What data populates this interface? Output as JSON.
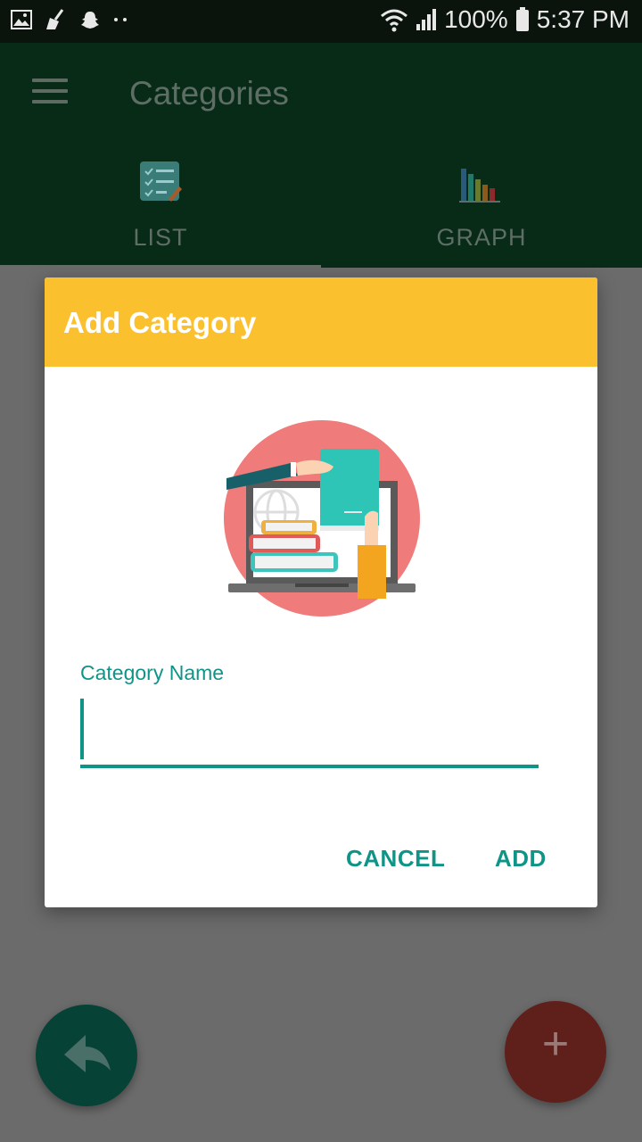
{
  "status_bar": {
    "battery": "100%",
    "time": "5:37 PM",
    "icons": [
      "image-icon",
      "broom-icon",
      "snapchat-icon",
      "dots-icon",
      "wifi-icon",
      "signal-icon",
      "battery-icon"
    ]
  },
  "app_bar": {
    "title": "Categories",
    "menu_icon": "hamburger-menu-icon"
  },
  "tabs": [
    {
      "label": "LIST",
      "icon": "checklist-icon",
      "selected": true
    },
    {
      "label": "GRAPH",
      "icon": "bar-graph-icon",
      "selected": false
    }
  ],
  "dialog": {
    "title": "Add Category",
    "field_label": "Category Name",
    "field_value": "",
    "cancel_label": "CANCEL",
    "add_label": "ADD",
    "header_color": "#fbc02d",
    "accent_color": "#0f9488"
  },
  "fabs": {
    "back_icon": "reply-arrow-icon",
    "add_icon": "plus-icon",
    "add_symbol": "+"
  }
}
